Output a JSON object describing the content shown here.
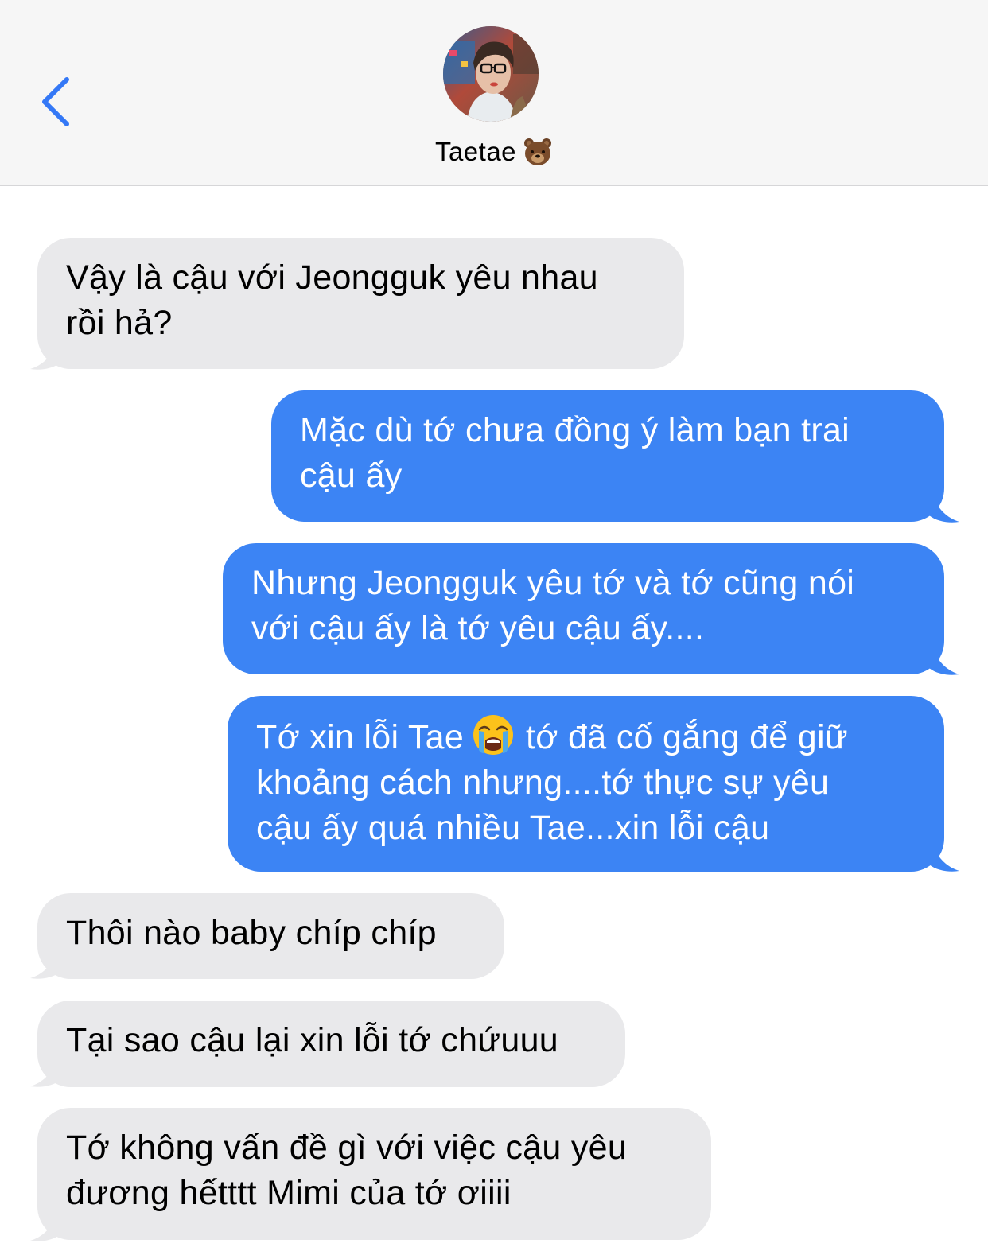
{
  "header": {
    "contact_name": "Taetae",
    "contact_emoji": "bear-face-emoji",
    "back_icon": "chevron-left-icon",
    "avatar": "contact-avatar-photo"
  },
  "colors": {
    "incoming_bubble": "#e9e9eb",
    "outgoing_bubble": "#3c84f4",
    "header_bg": "#f6f6f6",
    "accent": "#3478f6"
  },
  "messages": [
    {
      "direction": "incoming",
      "lines": [
        "Vậy là cậu với Jeongguk yêu nhau",
        "rồi hả?"
      ]
    },
    {
      "direction": "outgoing",
      "lines": [
        "Mặc dù tớ chưa đồng ý làm bạn trai",
        "cậu ấy"
      ]
    },
    {
      "direction": "outgoing",
      "lines": [
        "Nhưng Jeongguk yêu tớ và tớ cũng nói",
        "với cậu ấy là tớ yêu cậu ấy...."
      ]
    },
    {
      "direction": "outgoing",
      "line1_before_emoji": "Tớ xin lỗi Tae",
      "emoji": "loudly-crying-face-emoji",
      "line1_after_emoji": "tớ đã cố gắng để giữ",
      "lines_rest": [
        "khoảng cách nhưng....tớ thực sự yêu",
        "cậu ấy quá nhiều Tae...xin lỗi cậu"
      ]
    },
    {
      "direction": "incoming",
      "lines": [
        "Thôi nào baby chíp chíp"
      ]
    },
    {
      "direction": "incoming",
      "lines": [
        "Tại sao cậu lại xin lỗi tớ chứuuu"
      ]
    },
    {
      "direction": "incoming",
      "lines": [
        "Tớ không vấn đề gì với việc cậu yêu",
        "đương hếtttt Mimi của tớ ơiiii"
      ]
    }
  ]
}
